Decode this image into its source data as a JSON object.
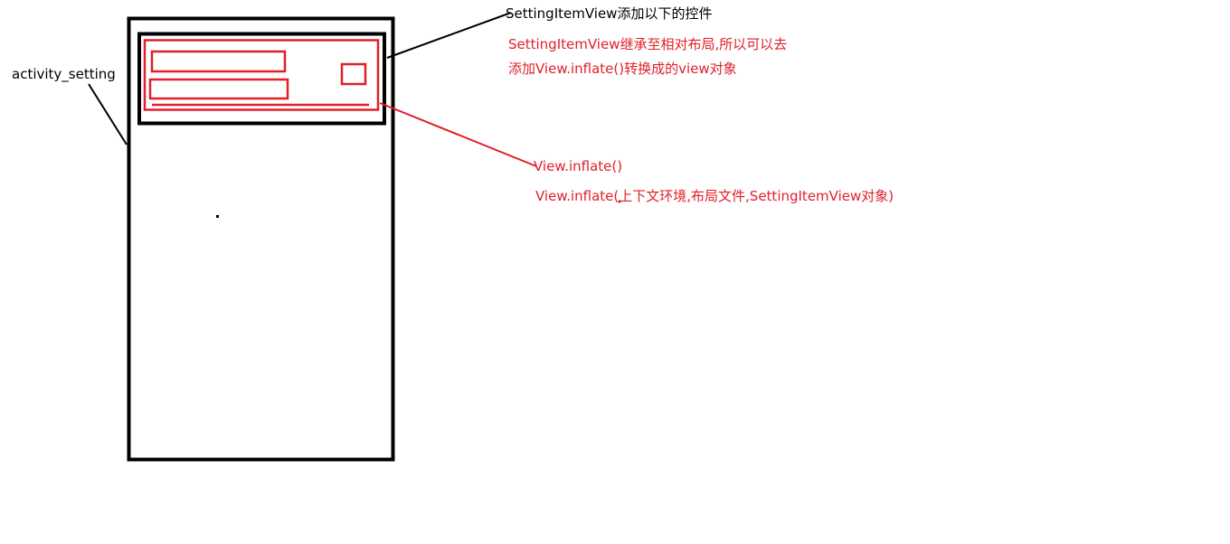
{
  "labels": {
    "activity_setting": "activity_setting",
    "setting_item_view_title": "SettingItemView添加以下的控件",
    "setting_item_view_note_line1": "SettingItemView继承至相对布局,所以可以去",
    "setting_item_view_note_line2": "添加View.inflate()转换成的view对象",
    "inflate_title": "View.inflate()",
    "inflate_signature": "View.inflate(上下文环境,布局文件,SettingItemView对象)"
  },
  "colors": {
    "outline": "#000000",
    "highlight": "#e0202a",
    "background": "#ffffff"
  }
}
